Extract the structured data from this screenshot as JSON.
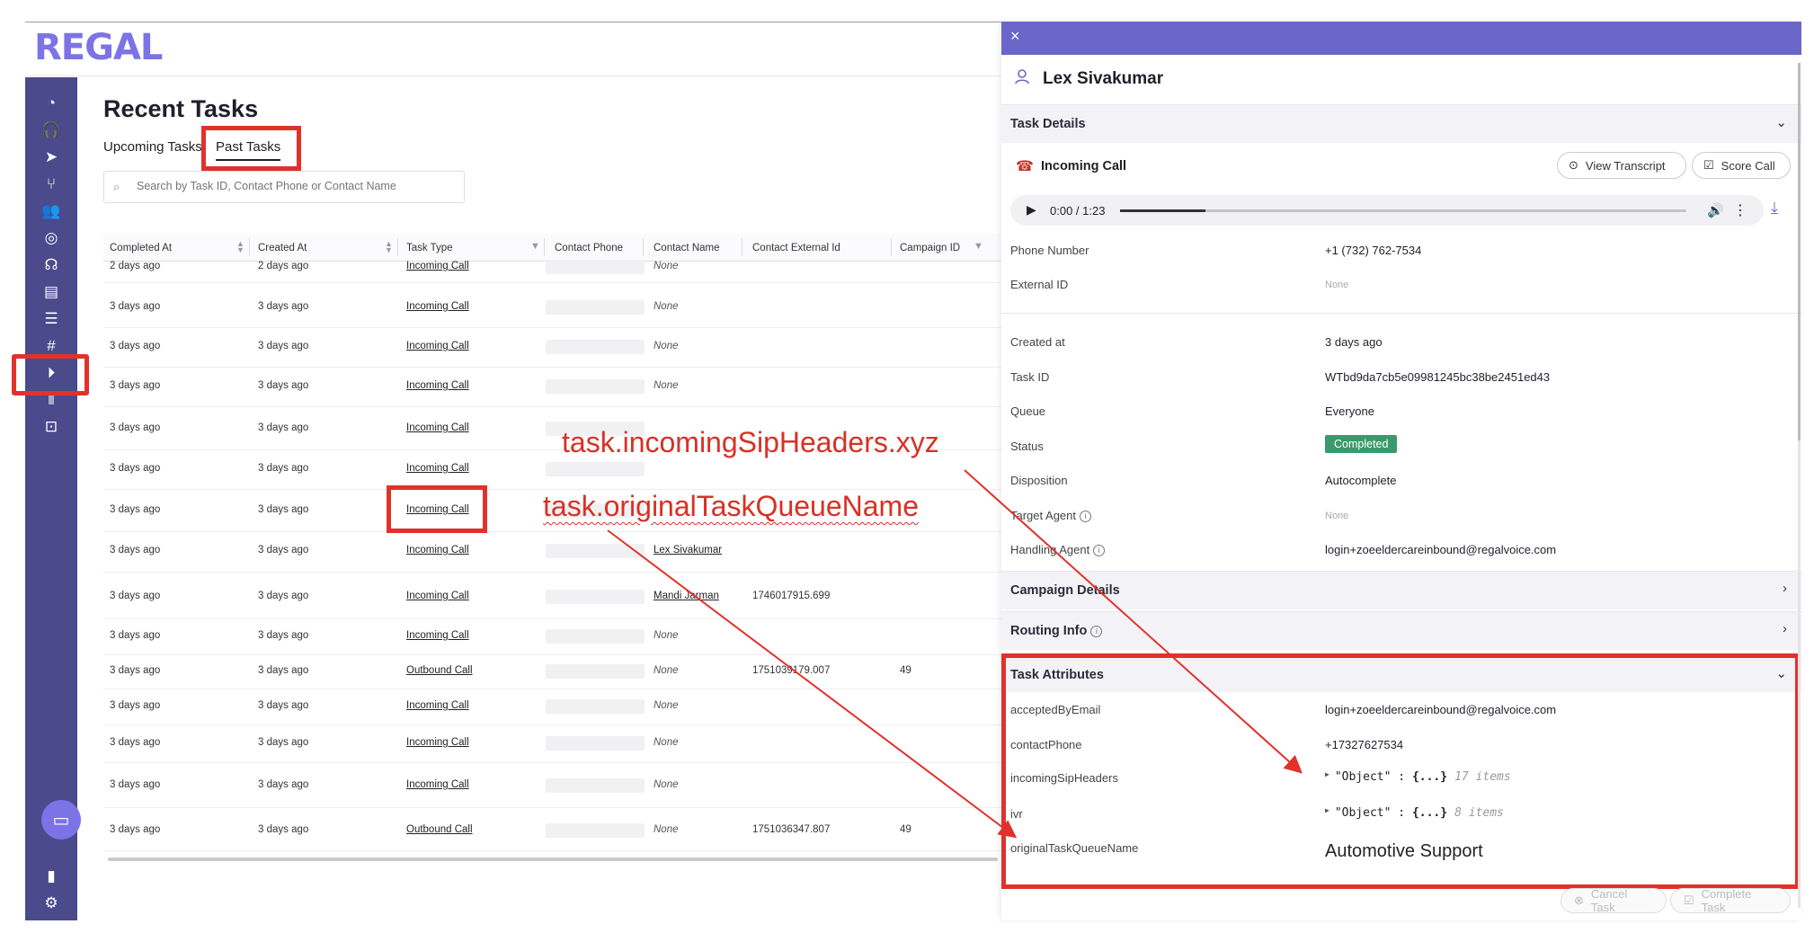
{
  "app": {
    "logo": "REGAL"
  },
  "sidebar": {
    "items": [
      {
        "name": "dashboard-icon",
        "glyph": "◔"
      },
      {
        "name": "headset-icon",
        "glyph": "🎧"
      },
      {
        "name": "send-icon",
        "glyph": "➤"
      },
      {
        "name": "branch-icon",
        "glyph": "⑂"
      },
      {
        "name": "contacts-icon",
        "glyph": "👥"
      },
      {
        "name": "target-icon",
        "glyph": "◎"
      },
      {
        "name": "agent-icon",
        "glyph": "☊"
      },
      {
        "name": "list-card-icon",
        "glyph": "▤"
      },
      {
        "name": "tasks-icon",
        "glyph": "☰"
      },
      {
        "name": "hashtag-icon",
        "glyph": "#"
      },
      {
        "name": "play-icon",
        "glyph": "⏵"
      },
      {
        "name": "waveform-icon",
        "glyph": "⦀"
      },
      {
        "name": "bot-icon",
        "glyph": "⊡"
      }
    ],
    "bottom": [
      {
        "name": "chart-icon",
        "glyph": "▮"
      },
      {
        "name": "settings-icon",
        "glyph": "⚙"
      }
    ],
    "chat_glyph": "▭"
  },
  "main": {
    "title": "Recent Tasks",
    "tabs": [
      {
        "label": "Upcoming Tasks",
        "active": false
      },
      {
        "label": "Past Tasks",
        "active": true
      }
    ],
    "search_placeholder": "Search by Task ID, Contact Phone or Contact Name",
    "columns": [
      "Completed At",
      "Created At",
      "Task Type",
      "Contact Phone",
      "Contact Name",
      "Contact External Id",
      "Campaign ID"
    ],
    "rows": [
      {
        "completed": "2 days ago",
        "created": "2 days ago",
        "type": "Incoming Call",
        "name": "None",
        "ext": "",
        "campaign": ""
      },
      {
        "completed": "3 days ago",
        "created": "3 days ago",
        "type": "Incoming Call",
        "name": "None",
        "ext": "",
        "campaign": ""
      },
      {
        "completed": "3 days ago",
        "created": "3 days ago",
        "type": "Incoming Call",
        "name": "None",
        "ext": "",
        "campaign": ""
      },
      {
        "completed": "3 days ago",
        "created": "3 days ago",
        "type": "Incoming Call",
        "name": "None",
        "ext": "",
        "campaign": ""
      },
      {
        "completed": "3 days ago",
        "created": "3 days ago",
        "type": "Incoming Call",
        "name": "",
        "ext": "",
        "campaign": ""
      },
      {
        "completed": "3 days ago",
        "created": "3 days ago",
        "type": "Incoming Call",
        "name": "",
        "ext": "",
        "campaign": ""
      },
      {
        "completed": "3 days ago",
        "created": "3 days ago",
        "type": "Incoming Call",
        "name": "",
        "ext": "",
        "campaign": ""
      },
      {
        "completed": "3 days ago",
        "created": "3 days ago",
        "type": "Incoming Call",
        "name": "Lex Sivakumar",
        "ext": "",
        "campaign": ""
      },
      {
        "completed": "3 days ago",
        "created": "3 days ago",
        "type": "Incoming Call",
        "name": "Mandi Jarman",
        "ext": "1746017915.699",
        "campaign": ""
      },
      {
        "completed": "3 days ago",
        "created": "3 days ago",
        "type": "Incoming Call",
        "name": "None",
        "ext": "",
        "campaign": ""
      },
      {
        "completed": "3 days ago",
        "created": "3 days ago",
        "type": "Outbound Call",
        "name": "None",
        "ext": "1751039179.007",
        "campaign": "49"
      },
      {
        "completed": "3 days ago",
        "created": "3 days ago",
        "type": "Incoming Call",
        "name": "None",
        "ext": "",
        "campaign": ""
      },
      {
        "completed": "3 days ago",
        "created": "3 days ago",
        "type": "Incoming Call",
        "name": "None",
        "ext": "",
        "campaign": ""
      },
      {
        "completed": "3 days ago",
        "created": "3 days ago",
        "type": "Incoming Call",
        "name": "None",
        "ext": "",
        "campaign": ""
      },
      {
        "completed": "3 days ago",
        "created": "3 days ago",
        "type": "Outbound Call",
        "name": "None",
        "ext": "1751036347.807",
        "campaign": "49"
      }
    ]
  },
  "annotations": {
    "sip_headers": "task.incomingSipHeaders.xyz",
    "queue_name": "task.originalTaskQueueName"
  },
  "panel": {
    "close_glyph": "×",
    "contact_name": "Lex Sivakumar",
    "sections": {
      "task_details": "Task Details",
      "campaign_details": "Campaign Details",
      "routing_info": "Routing Info",
      "task_attributes": "Task Attributes"
    },
    "call": {
      "title": "Incoming Call",
      "view_transcript": "View Transcript",
      "score_call": "Score Call",
      "time": "0:00 / 1:23",
      "progress": 0.15
    },
    "details": [
      {
        "label": "Phone Number",
        "value": "+1 (732) 762-7534",
        "muted": false
      },
      {
        "label": "External ID",
        "value": "None",
        "muted": true
      },
      {
        "label": "Created at",
        "value": "3 days ago",
        "muted": false
      },
      {
        "label": "Task ID",
        "value": "WTbd9da7cb5e09981245bc38be2451ed43",
        "muted": false
      },
      {
        "label": "Queue",
        "value": "Everyone",
        "muted": false
      },
      {
        "label": "Status",
        "value": "Completed",
        "muted": false
      },
      {
        "label": "Disposition",
        "value": "Autocomplete",
        "muted": false
      },
      {
        "label": "Target Agent",
        "value": "None",
        "muted": true
      },
      {
        "label": "Handling Agent",
        "value": "login+zoeeldercareinbound@regalvoice.com",
        "muted": false
      }
    ],
    "attributes": {
      "accepted_label": "acceptedByEmail",
      "accepted_value": "login+zoeeldercareinbound@regalvoice.com",
      "phone_label": "contactPhone",
      "phone_value": "+17327627534",
      "sip_label": "incomingSipHeaders",
      "sip_key": "\"Object\"",
      "sip_braces": "{...}",
      "sip_count": "17 items",
      "ivr_label": "ivr",
      "ivr_key": "\"Object\"",
      "ivr_braces": "{...}",
      "ivr_count": "8 items",
      "queue_label": "originalTaskQueueName",
      "queue_value": "Automotive Support"
    },
    "footer": {
      "cancel": "Cancel Task",
      "complete": "Complete Task"
    }
  },
  "colors": {
    "brand": "#7c73e6",
    "sidebar": "#4a4a8c",
    "panel_header": "#6b66c9",
    "highlight": "#e0322b",
    "status_completed": "#3a9a6b"
  }
}
